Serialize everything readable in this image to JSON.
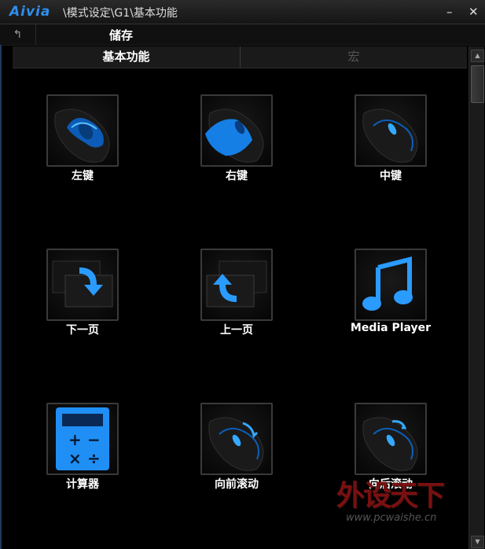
{
  "window": {
    "logo": "Aivia",
    "path": "\\模式设定\\G1\\基本功能",
    "minimize": "–",
    "close": "✕"
  },
  "subheader": {
    "back_icon": "↰",
    "title": "储存"
  },
  "tabs": [
    {
      "label": "基本功能",
      "active": true
    },
    {
      "label": "宏",
      "active": false
    }
  ],
  "scrollbar": {
    "up": "▲",
    "down": "▼"
  },
  "tiles": [
    {
      "label": "左键",
      "icon": "mouse-left-click-icon"
    },
    {
      "label": "右键",
      "icon": "mouse-right-click-icon"
    },
    {
      "label": "中键",
      "icon": "mouse-middle-click-icon"
    },
    {
      "label": "下一页",
      "icon": "next-page-icon"
    },
    {
      "label": "上一页",
      "icon": "previous-page-icon"
    },
    {
      "label": "Media Player",
      "icon": "music-note-icon"
    },
    {
      "label": "计算器",
      "icon": "calculator-icon"
    },
    {
      "label": "向前滚动",
      "icon": "scroll-forward-icon"
    },
    {
      "label": "向后滚动",
      "icon": "scroll-backward-icon"
    }
  ],
  "watermark": {
    "main": "外设天下",
    "sub": "www.pcwaishe.cn"
  },
  "colors": {
    "accent_blue": "#1e90ff",
    "glow_blue": "#35a8ff",
    "background": "#000000"
  }
}
